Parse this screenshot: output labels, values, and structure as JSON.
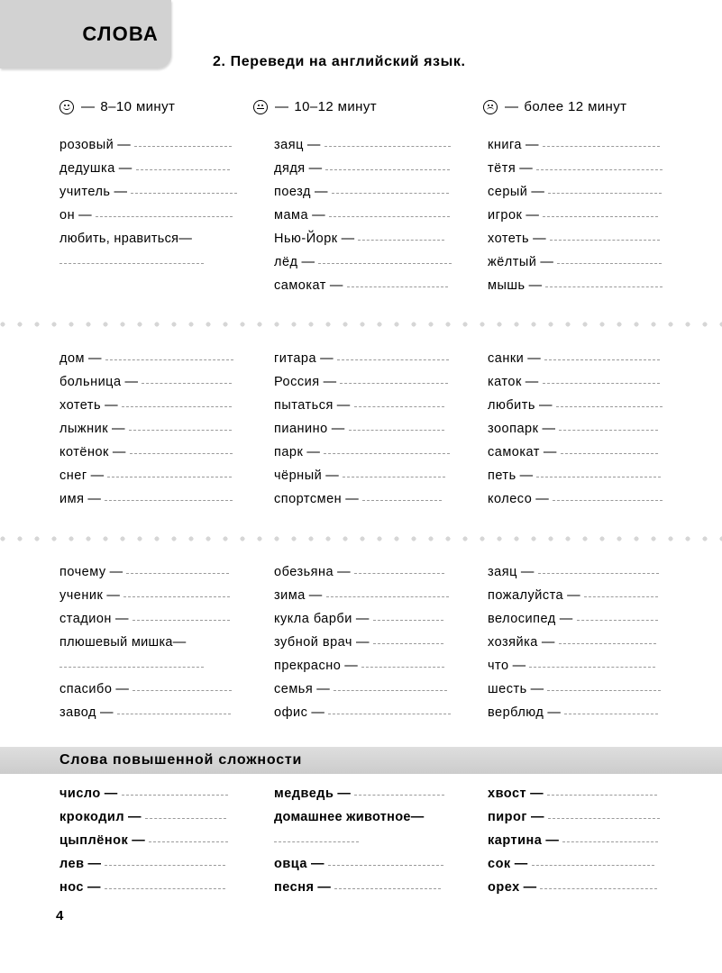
{
  "tab": {
    "label": "СЛОВА"
  },
  "exercise": {
    "number": "2.",
    "title": "Переведи на английский язык."
  },
  "legend": {
    "items": [
      {
        "face": "happy",
        "dash": "—",
        "text": "8–10 минут"
      },
      {
        "face": "neutral",
        "dash": "—",
        "text": "10–12 минут"
      },
      {
        "face": "sad",
        "dash": "—",
        "text": "более 12 минут"
      }
    ]
  },
  "dash": "—",
  "blocks": [
    {
      "columns": [
        {
          "entries": [
            {
              "word": "розовый",
              "wrap": false,
              "blank": 108
            },
            {
              "word": "дедушка",
              "wrap": false,
              "blank": 104
            },
            {
              "word": "учитель",
              "wrap": false,
              "blank": 118
            },
            {
              "word": "он",
              "wrap": false,
              "blank": 152
            },
            {
              "word": "любить, нравиться",
              "wrap": true,
              "blank": 160
            }
          ]
        },
        {
          "entries": [
            {
              "word": "заяц",
              "wrap": false,
              "blank": 140
            },
            {
              "word": "дядя",
              "wrap": false,
              "blank": 138
            },
            {
              "word": "поезд",
              "wrap": false,
              "blank": 130
            },
            {
              "word": "мама",
              "wrap": false,
              "blank": 134
            },
            {
              "word": "Нью-Йорк",
              "wrap": false,
              "blank": 96
            },
            {
              "word": "лёд",
              "wrap": false,
              "blank": 148
            },
            {
              "word": "самокат",
              "wrap": false,
              "blank": 112
            }
          ]
        },
        {
          "entries": [
            {
              "word": "книга",
              "wrap": false,
              "blank": 130
            },
            {
              "word": "тётя",
              "wrap": false,
              "blank": 140
            },
            {
              "word": "серый",
              "wrap": false,
              "blank": 126
            },
            {
              "word": "игрок",
              "wrap": false,
              "blank": 128
            },
            {
              "word": "хотеть",
              "wrap": false,
              "blank": 122
            },
            {
              "word": "жёлтый",
              "wrap": false,
              "blank": 116
            },
            {
              "word": "мышь",
              "wrap": false,
              "blank": 130
            }
          ]
        }
      ]
    },
    {
      "columns": [
        {
          "entries": [
            {
              "word": "дом",
              "wrap": false,
              "blank": 142
            },
            {
              "word": "больница",
              "wrap": false,
              "blank": 100
            },
            {
              "word": "хотеть",
              "wrap": false,
              "blank": 122
            },
            {
              "word": "лыжник",
              "wrap": false,
              "blank": 114
            },
            {
              "word": "котёнок",
              "wrap": false,
              "blank": 114
            },
            {
              "word": "снег",
              "wrap": false,
              "blank": 138
            },
            {
              "word": "имя",
              "wrap": false,
              "blank": 142
            }
          ]
        },
        {
          "entries": [
            {
              "word": "гитара",
              "wrap": false,
              "blank": 124
            },
            {
              "word": "Россия",
              "wrap": false,
              "blank": 120
            },
            {
              "word": "пытаться",
              "wrap": false,
              "blank": 100
            },
            {
              "word": "пианино",
              "wrap": false,
              "blank": 106
            },
            {
              "word": "парк",
              "wrap": false,
              "blank": 140
            },
            {
              "word": "чёрный",
              "wrap": false,
              "blank": 114
            },
            {
              "word": "спортсмен",
              "wrap": false,
              "blank": 88
            }
          ]
        },
        {
          "entries": [
            {
              "word": "санки",
              "wrap": false,
              "blank": 128
            },
            {
              "word": "каток",
              "wrap": false,
              "blank": 130
            },
            {
              "word": "любить",
              "wrap": false,
              "blank": 118
            },
            {
              "word": "зоопарк",
              "wrap": false,
              "blank": 110
            },
            {
              "word": "самокат",
              "wrap": false,
              "blank": 108
            },
            {
              "word": "петь",
              "wrap": false,
              "blank": 138
            },
            {
              "word": "колесо",
              "wrap": false,
              "blank": 122
            }
          ]
        }
      ]
    },
    {
      "columns": [
        {
          "entries": [
            {
              "word": "почему",
              "wrap": false,
              "blank": 114
            },
            {
              "word": "ученик",
              "wrap": false,
              "blank": 118
            },
            {
              "word": "стадион",
              "wrap": false,
              "blank": 108
            },
            {
              "word": "плюшевый мишка",
              "wrap": true,
              "blank": 160
            },
            {
              "word": "спасибо",
              "wrap": false,
              "blank": 110
            },
            {
              "word": "завод",
              "wrap": false,
              "blank": 126
            }
          ]
        },
        {
          "entries": [
            {
              "word": "обезьяна",
              "wrap": false,
              "blank": 100
            },
            {
              "word": "зима",
              "wrap": false,
              "blank": 136
            },
            {
              "word": "кукла барби",
              "wrap": false,
              "blank": 78
            },
            {
              "word": "зубной врач",
              "wrap": false,
              "blank": 78
            },
            {
              "word": "прекрасно",
              "wrap": false,
              "blank": 92
            },
            {
              "word": "семья",
              "wrap": false,
              "blank": 126
            },
            {
              "word": "офис",
              "wrap": false,
              "blank": 136
            }
          ]
        },
        {
          "entries": [
            {
              "word": "заяц",
              "wrap": false,
              "blank": 134
            },
            {
              "word": "пожалуйста",
              "wrap": false,
              "blank": 82
            },
            {
              "word": "велосипед",
              "wrap": false,
              "blank": 90
            },
            {
              "word": "хозяйка",
              "wrap": false,
              "blank": 108
            },
            {
              "word": "что",
              "wrap": false,
              "blank": 140
            },
            {
              "word": "шесть",
              "wrap": false,
              "blank": 126
            },
            {
              "word": "верблюд",
              "wrap": false,
              "blank": 104
            }
          ]
        }
      ]
    }
  ],
  "advanced": {
    "header": "Слова повышенной сложности",
    "columns": [
      {
        "entries": [
          {
            "word": "число",
            "wrap": false,
            "blank": 118
          },
          {
            "word": "крокодил",
            "wrap": false,
            "blank": 90
          },
          {
            "word": "цыплёнок",
            "wrap": false,
            "blank": 88
          },
          {
            "word": "лев",
            "wrap": false,
            "blank": 134
          },
          {
            "word": "нос",
            "wrap": false,
            "blank": 134
          }
        ]
      },
      {
        "entries": [
          {
            "word": "медведь",
            "wrap": false,
            "blank": 100
          },
          {
            "word": "домашнее животное",
            "wrap": true,
            "blank": 94
          },
          {
            "word": "овца",
            "wrap": false,
            "blank": 128
          },
          {
            "word": "песня",
            "wrap": false,
            "blank": 118
          }
        ]
      },
      {
        "entries": [
          {
            "word": "хвост",
            "wrap": false,
            "blank": 122
          },
          {
            "word": "пирог",
            "wrap": false,
            "blank": 124
          },
          {
            "word": "картина",
            "wrap": false,
            "blank": 106
          },
          {
            "word": "сок",
            "wrap": false,
            "blank": 136
          },
          {
            "word": "орех",
            "wrap": false,
            "blank": 130
          }
        ]
      }
    ]
  },
  "page_number": "4"
}
